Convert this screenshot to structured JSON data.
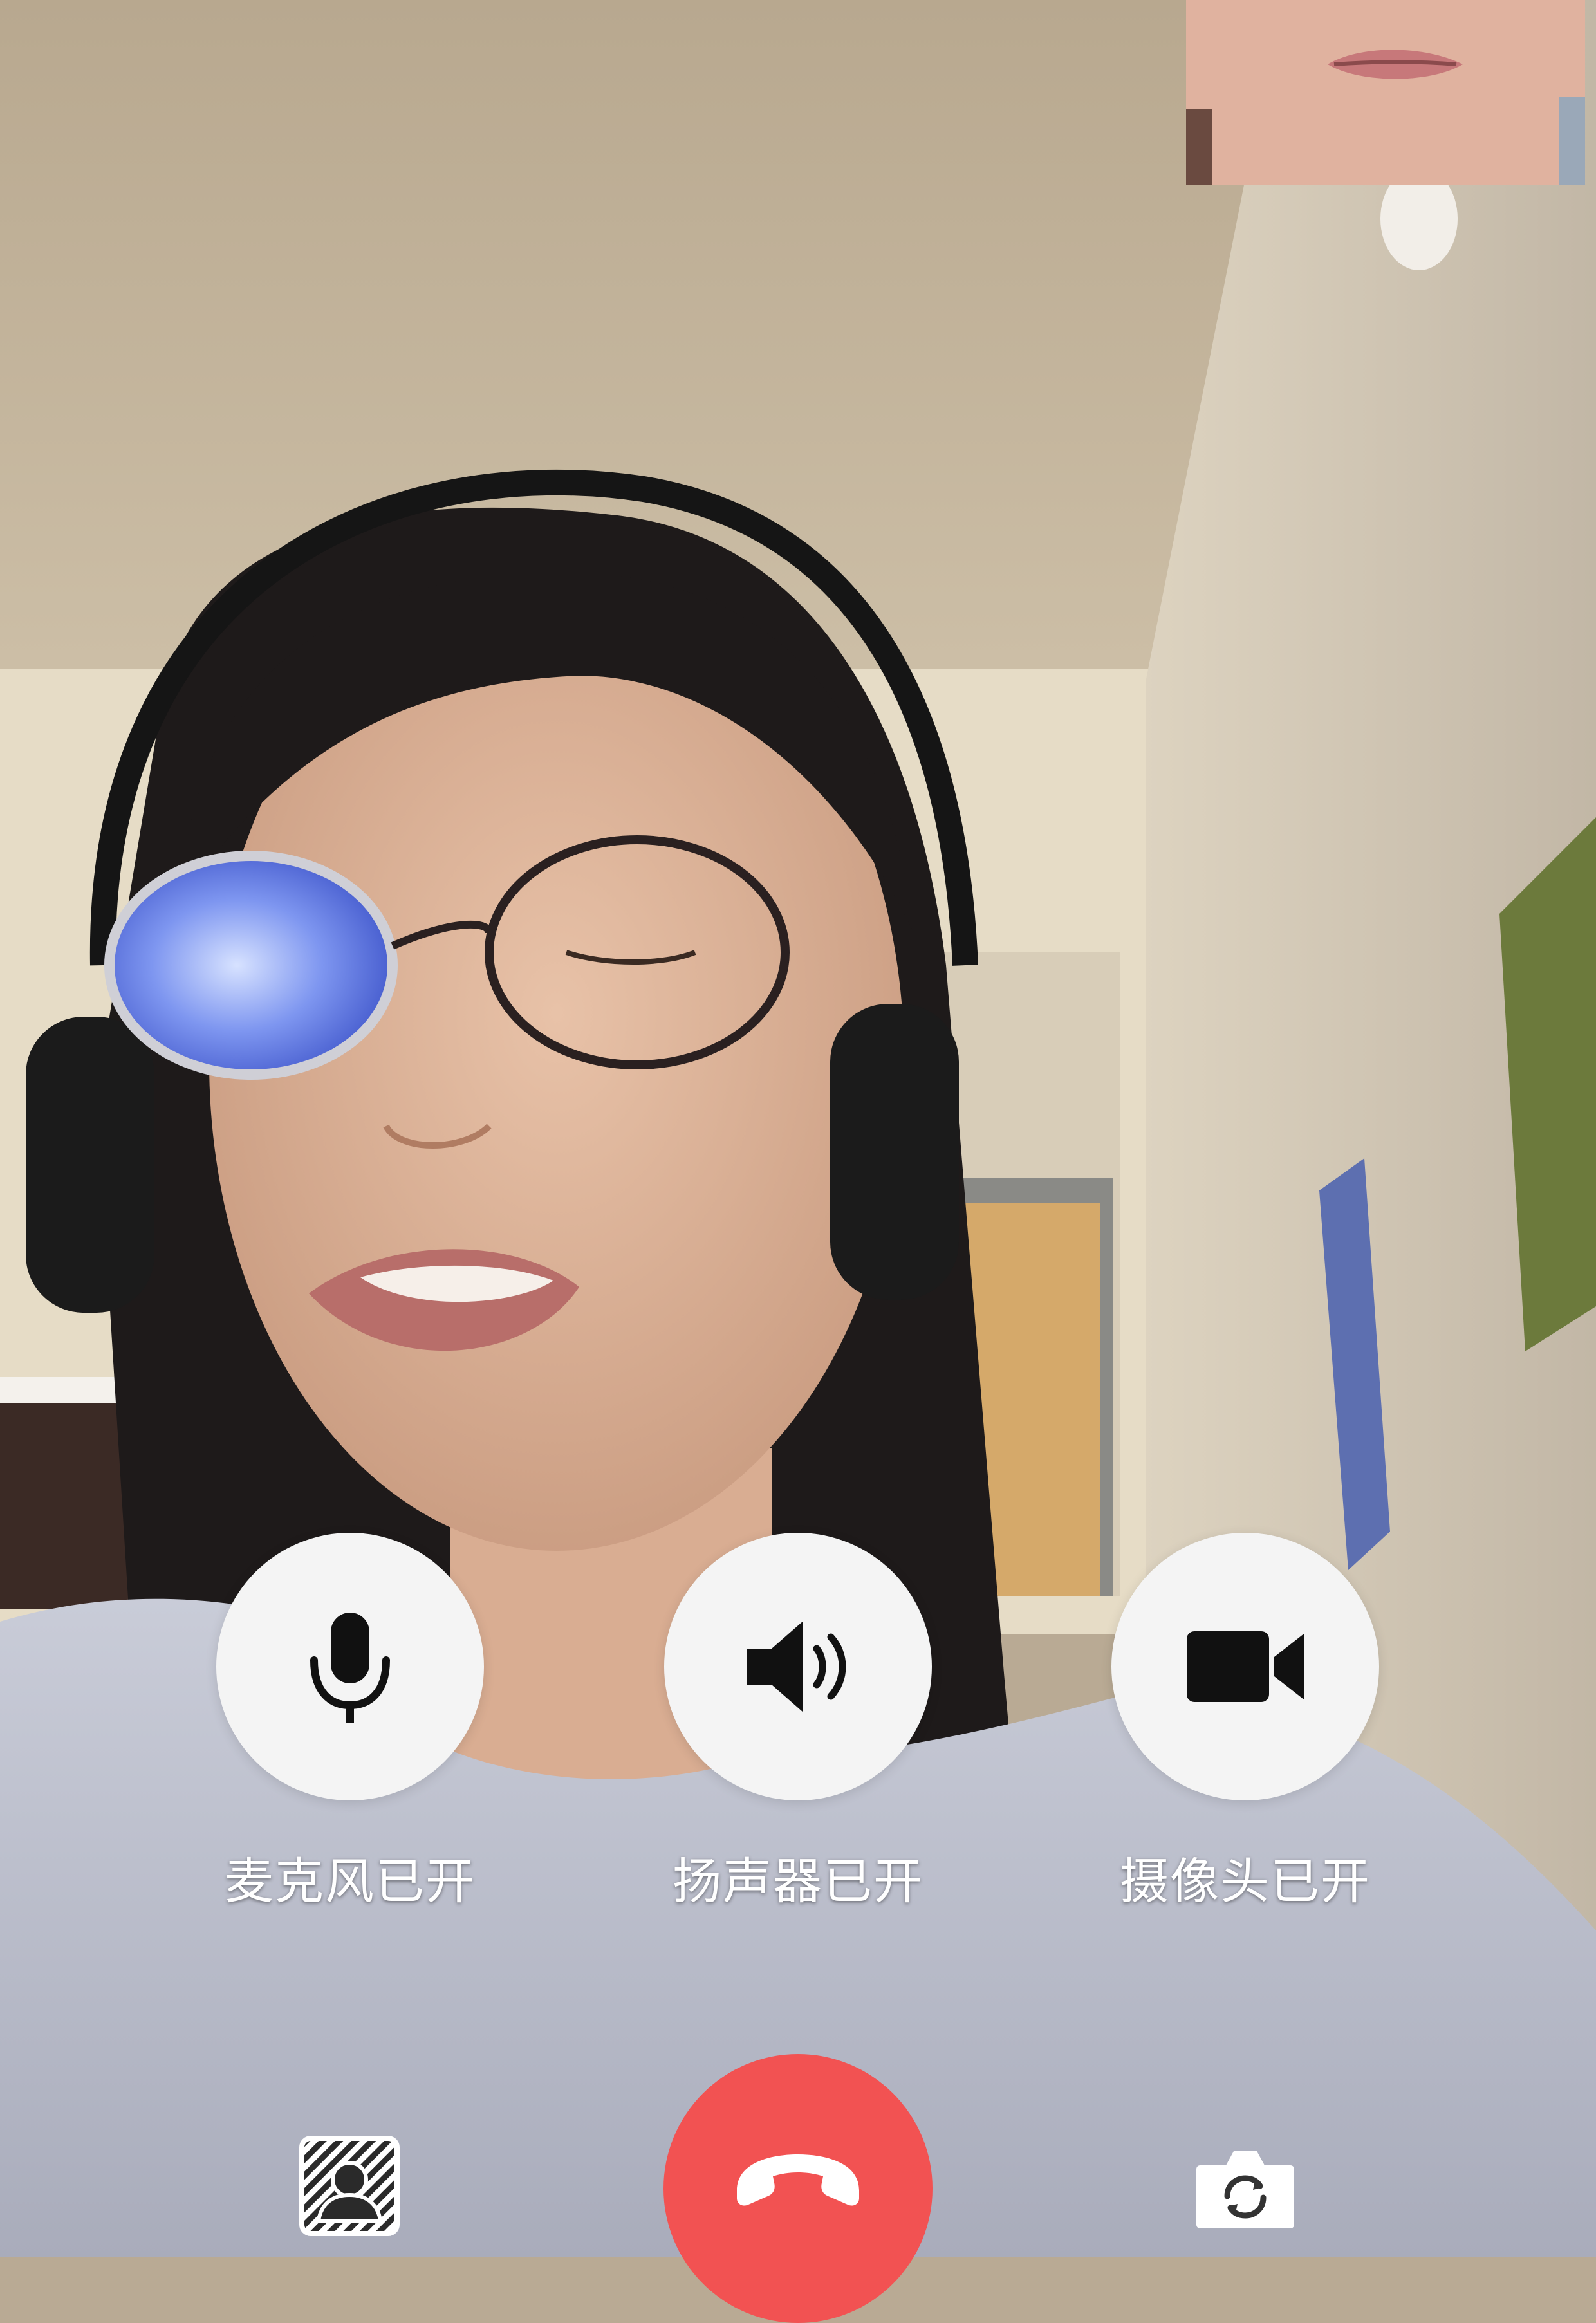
{
  "call": {
    "controls": [
      {
        "id": "mic",
        "label": "麦克风已开",
        "icon": "microphone-icon",
        "state": "on"
      },
      {
        "id": "speaker",
        "label": "扬声器已开",
        "icon": "speaker-icon",
        "state": "on"
      },
      {
        "id": "camera",
        "label": "摄像头已开",
        "icon": "video-camera-icon",
        "state": "on"
      }
    ],
    "bottom_bar": {
      "left_icon": "blur-background-icon",
      "center_icon": "hang-up-phone-icon",
      "right_icon": "switch-camera-icon"
    }
  },
  "colors": {
    "hangup": "#f25252",
    "control_bg": "#f4f4f4",
    "icon": "#111111",
    "label": "#ffffff"
  }
}
